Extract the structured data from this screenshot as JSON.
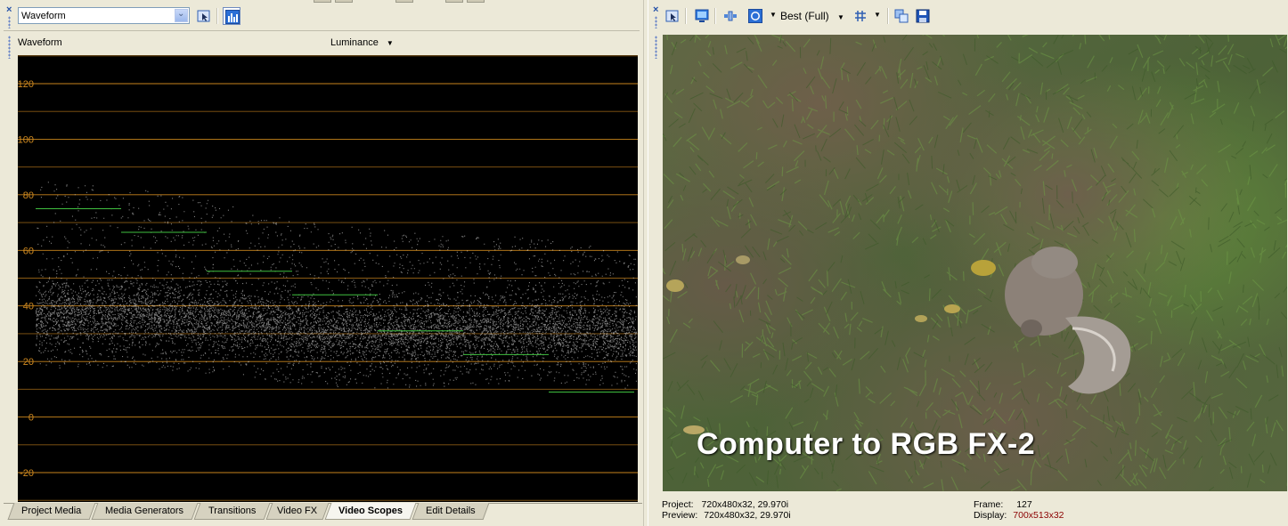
{
  "left_panel": {
    "scope_type_select": {
      "value": "Waveform",
      "options": [
        "Waveform"
      ]
    },
    "view_label": "Waveform",
    "channel_label": "Luminance",
    "scope_axis_ticks": [
      "120",
      "100",
      "80",
      "60",
      "40",
      "20",
      "0",
      "-20"
    ],
    "bottom_tabs": [
      {
        "label": "Project Media",
        "active": false
      },
      {
        "label": "Media Generators",
        "active": false
      },
      {
        "label": "Transitions",
        "active": false
      },
      {
        "label": "Video FX",
        "active": false
      },
      {
        "label": "Video Scopes",
        "active": true
      },
      {
        "label": "Edit Details",
        "active": false
      }
    ]
  },
  "right_panel": {
    "toolbar": {
      "quality_label": "Best (Full)"
    },
    "preview_overlay_text": "Computer to RGB FX-2",
    "status": {
      "project_label": "Project:",
      "project_value": "720x480x32, 29.970i",
      "preview_label": "Preview:",
      "preview_value": "720x480x32, 29.970i",
      "frame_label": "Frame:",
      "frame_value": "127",
      "display_label": "Display:",
      "display_value": "700x513x32"
    }
  },
  "colors": {
    "scope_grid": "#c8841c",
    "scope_grid_minor": "#8a5a14",
    "scope_tick_text": "#d08a20",
    "scope_trace": "#e6e6e6",
    "scope_reference": "#3fbf3f",
    "display_value_text": "#8b0000"
  },
  "icons": {
    "close": "close-x-icon",
    "scope_settings": "cursor-settings-icon",
    "update_scope": "bar-graph-icon",
    "preview_properties": "cursor-settings-icon",
    "external_monitor": "monitor-icon",
    "split_screen": "split-view-icon",
    "overlays": "circle-overlay-icon",
    "grid": "grid-icon",
    "copy_snapshot": "copy-snapshot-icon",
    "save_snapshot": "floppy-disk-icon"
  }
}
